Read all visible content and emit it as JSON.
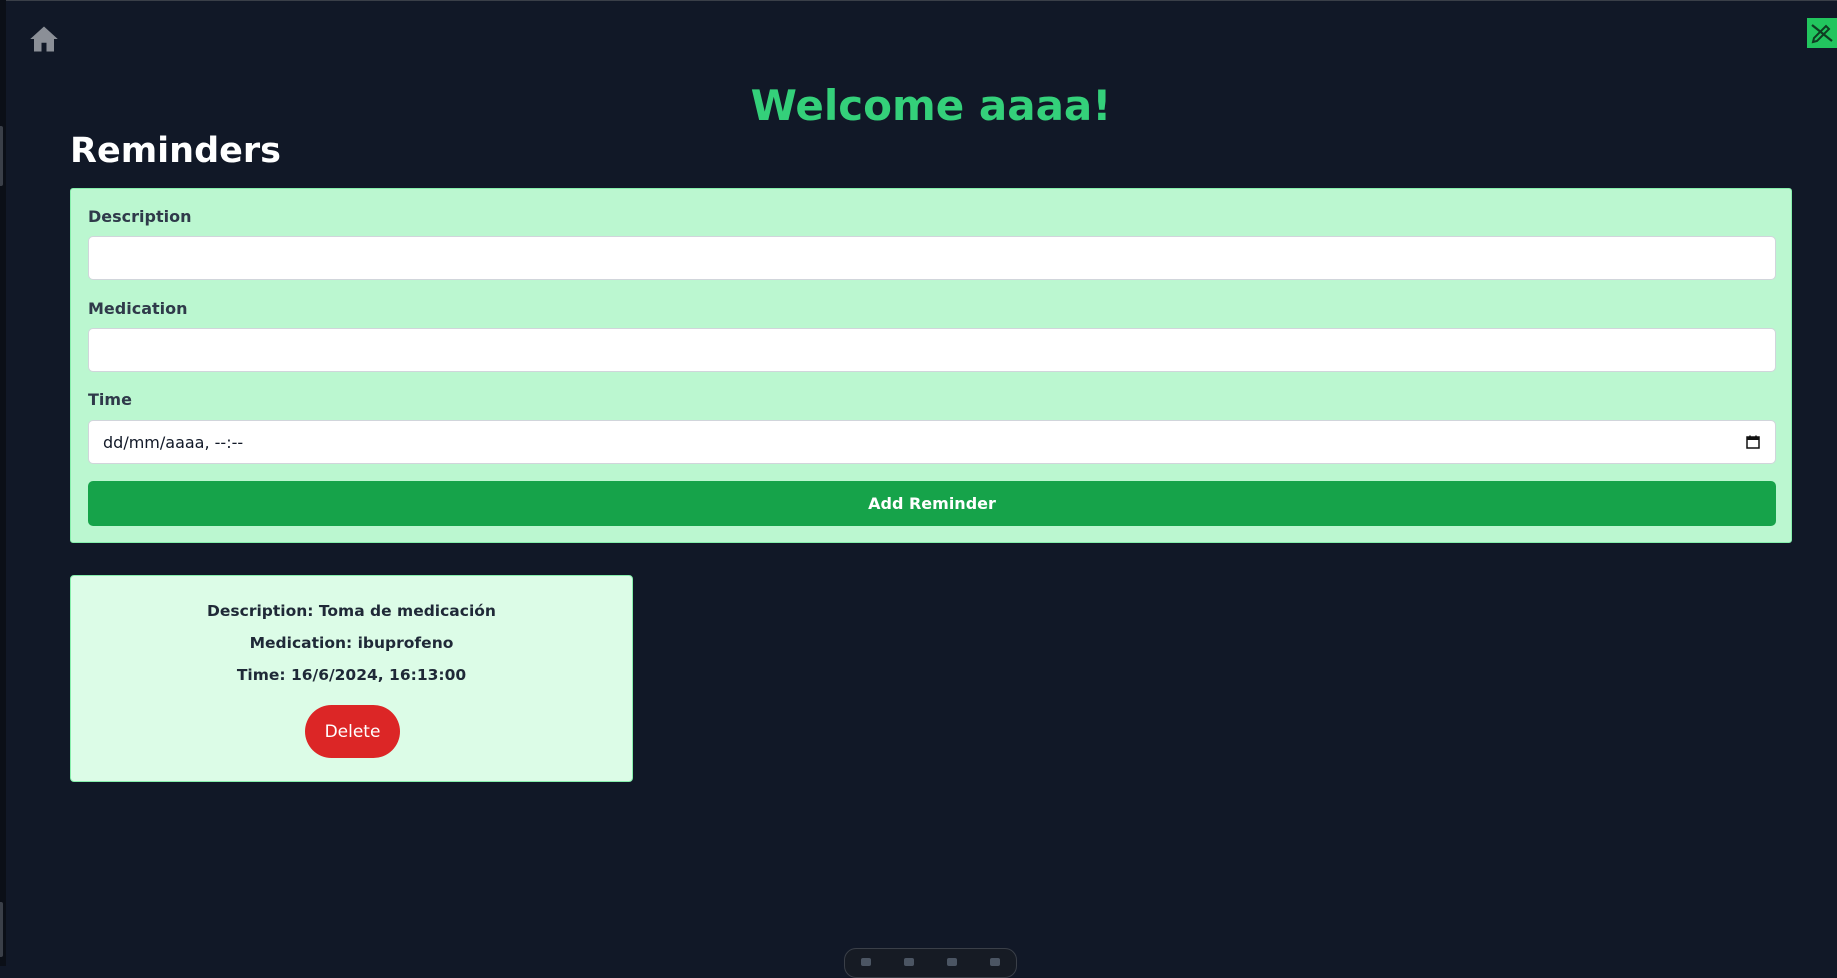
{
  "header": {
    "welcome": "Welcome aaaa!",
    "home_icon": "home-icon",
    "badge_icon": "edit-off-icon"
  },
  "reminders": {
    "title": "Reminders",
    "form": {
      "description_label": "Description",
      "description_value": "",
      "medication_label": "Medication",
      "medication_value": "",
      "time_label": "Time",
      "time_value": "dd/mm/aaaa, --:--",
      "time_icon": "calendar-icon",
      "submit_label": "Add Reminder"
    },
    "items": [
      {
        "description": "Description: Toma de medicación",
        "medication": "Medication: ibuprofeno",
        "time": "Time: 16/6/2024, 16:13:00",
        "delete_label": "Delete"
      }
    ]
  },
  "colors": {
    "background": "#111827",
    "accent_green": "#34d07a",
    "panel": "#bbf7d0",
    "card": "#dcfce7",
    "primary_button": "#16a34a",
    "danger_button": "#dc2626"
  }
}
